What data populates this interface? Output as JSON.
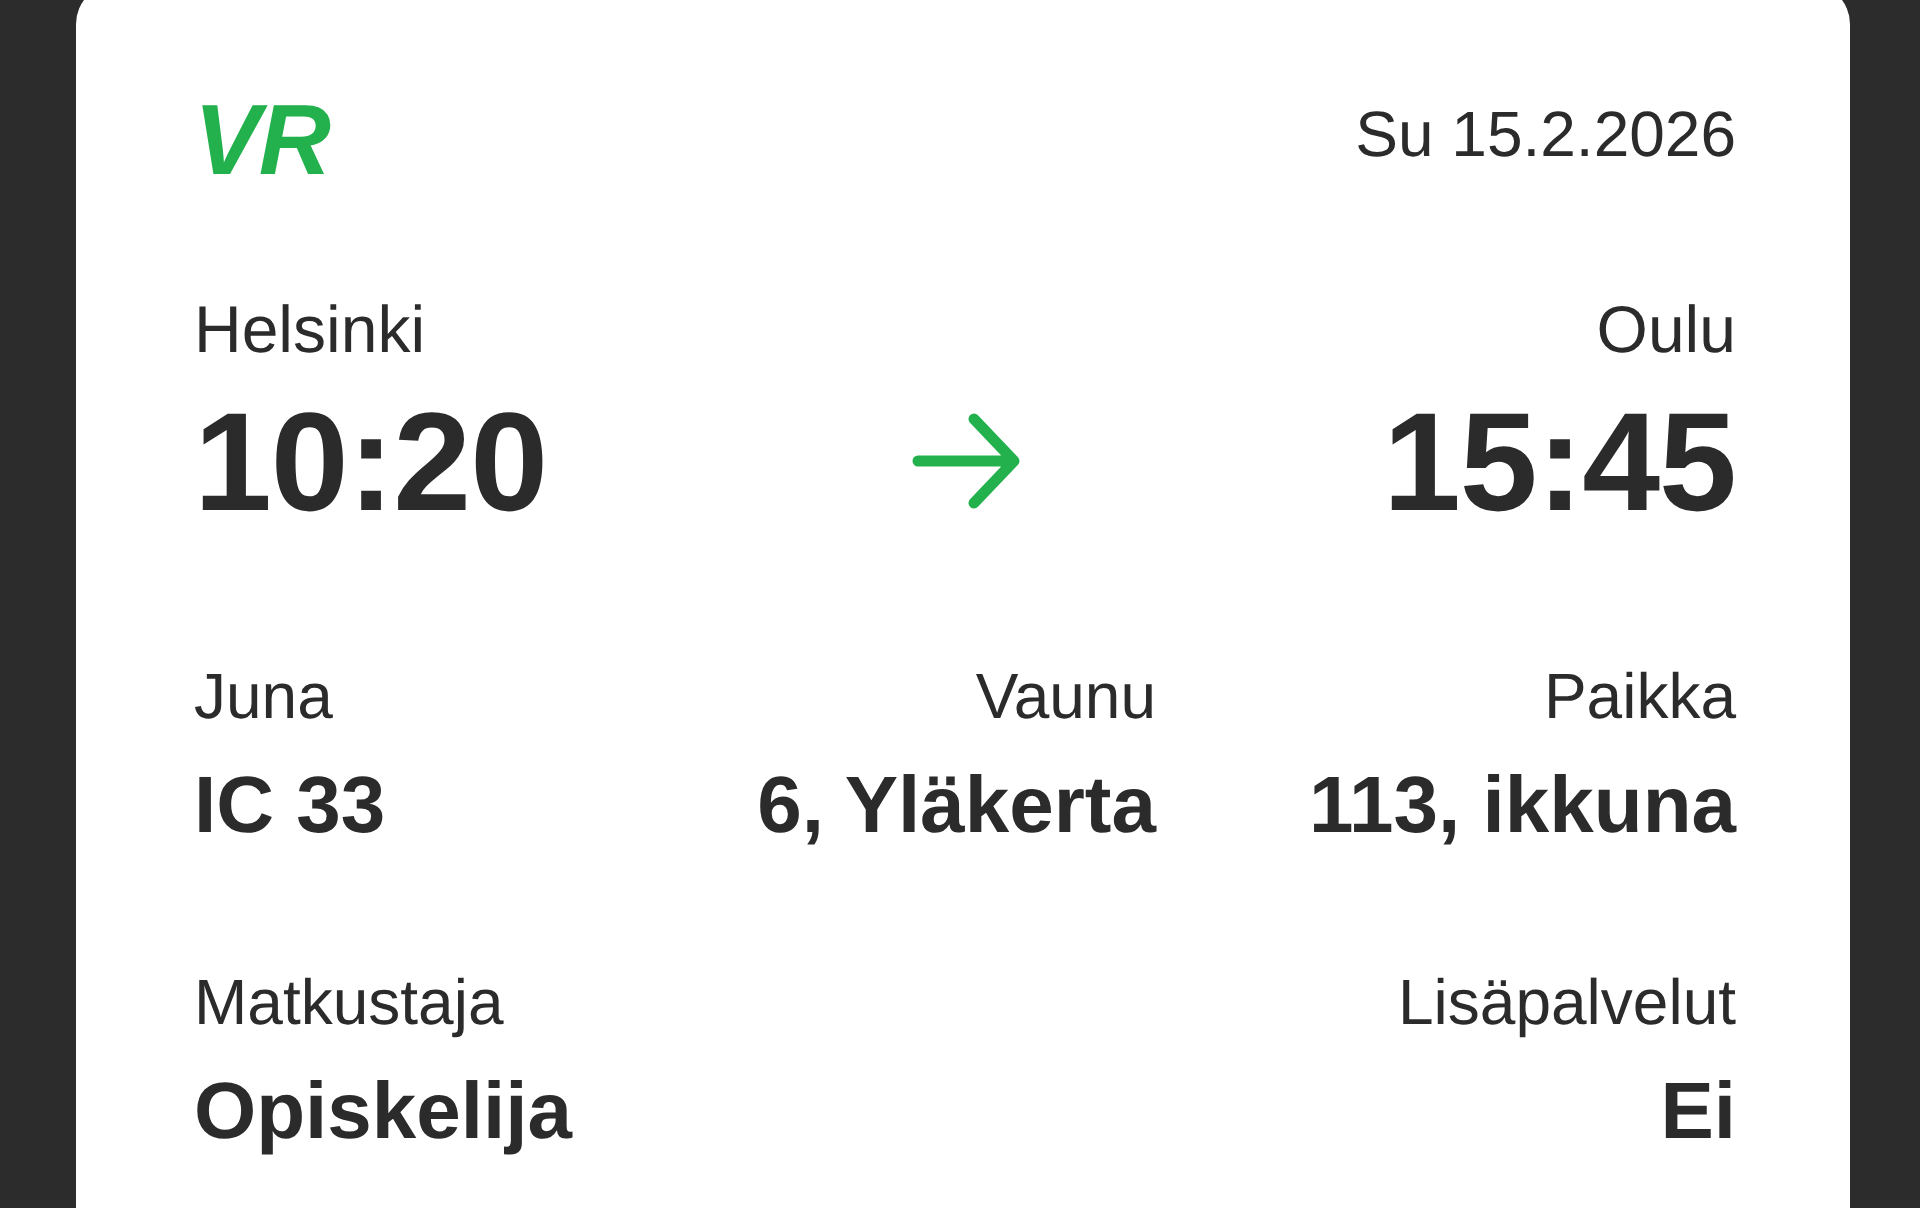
{
  "header": {
    "logo": "VR",
    "date": "Su 15.2.2026"
  },
  "route": {
    "from": {
      "station": "Helsinki",
      "time": "10:20"
    },
    "to": {
      "station": "Oulu",
      "time": "15:45"
    }
  },
  "details": [
    {
      "items": [
        {
          "label": "Juna",
          "value": "IC 33"
        },
        {
          "label": "Vaunu",
          "value": "6, Yläkerta"
        },
        {
          "label": "Paikka",
          "value": "113, ikkuna"
        }
      ]
    },
    {
      "items": [
        {
          "label": "Matkustaja",
          "value": "Opiskelija"
        },
        {
          "label": "Lisäpalvelut",
          "value": "Ei"
        }
      ]
    }
  ]
}
